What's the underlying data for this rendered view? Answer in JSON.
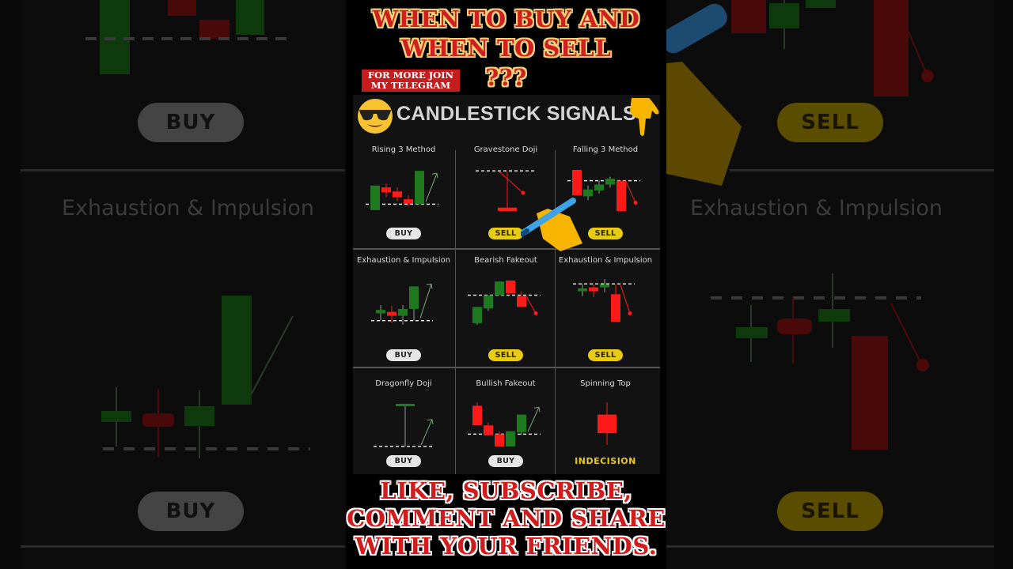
{
  "headline_top": [
    "WHEN TO BUY AND",
    "WHEN TO SELL",
    "???"
  ],
  "telegram_note": [
    "FOR MORE JOIN",
    "MY TELEGRAM"
  ],
  "card": {
    "title": "CANDLESTICK SIGNALS",
    "left_icon": "sunglasses-face-emoji",
    "right_icon": "pointing-down-hand-emoji",
    "overlay_icon": "writing-hand-emoji"
  },
  "headline_bottom": [
    "LIKE, SUBSCRIBE,",
    "COMMENT AND SHARE",
    "WITH YOUR FRIENDS."
  ],
  "colors": {
    "bull": "#1f7a1f",
    "bear": "#ff1a1a",
    "buy_pill": "#e6e6e6",
    "sell_pill": "#e8cc14",
    "headline_red": "#cf1f1f",
    "card_bg": "#121212"
  },
  "patterns": [
    {
      "name": "Rising 3 Method",
      "signal": "BUY",
      "level": 0.78,
      "arrow": "up",
      "candles": [
        {
          "type": "bull",
          "open": 0.9,
          "close": 0.4,
          "high": 0.4,
          "low": 0.9
        },
        {
          "type": "bear",
          "open": 0.44,
          "close": 0.54,
          "high": 0.36,
          "low": 0.64
        },
        {
          "type": "bear",
          "open": 0.52,
          "close": 0.64,
          "high": 0.44,
          "low": 0.72
        },
        {
          "type": "bear",
          "open": 0.68,
          "close": 0.77,
          "high": 0.6,
          "low": 0.82
        },
        {
          "type": "bull",
          "open": 0.78,
          "close": 0.1,
          "high": 0.1,
          "low": 0.78
        }
      ]
    },
    {
      "name": "Gravestone Doji",
      "signal": "SELL",
      "level": 0.1,
      "arrow": "down-dot",
      "candles": [
        {
          "type": "bear",
          "open": 0.85,
          "close": 0.92,
          "high": 0.12,
          "low": 0.92,
          "wide": true
        }
      ]
    },
    {
      "name": "Falling 3 Method",
      "signal": "SELL",
      "level": 0.3,
      "arrow": "down-dot",
      "candles": [
        {
          "type": "bear",
          "open": 0.08,
          "close": 0.6,
          "high": 0.08,
          "low": 0.6
        },
        {
          "type": "bull",
          "open": 0.62,
          "close": 0.48,
          "high": 0.4,
          "low": 0.7
        },
        {
          "type": "bull",
          "open": 0.5,
          "close": 0.38,
          "high": 0.3,
          "low": 0.56
        },
        {
          "type": "bull",
          "open": 0.38,
          "close": 0.26,
          "high": 0.22,
          "low": 0.44
        },
        {
          "type": "bear",
          "open": 0.3,
          "close": 0.92,
          "high": 0.3,
          "low": 0.92
        }
      ]
    },
    {
      "name": "Exhaustion & Impulsion",
      "signal": "BUY",
      "level": 0.9,
      "arrow": "up",
      "candles": [
        {
          "type": "bull",
          "open": 0.75,
          "close": 0.68,
          "high": 0.58,
          "low": 0.9
        },
        {
          "type": "bear",
          "open": 0.72,
          "close": 0.8,
          "high": 0.6,
          "low": 0.95
        },
        {
          "type": "bull",
          "open": 0.8,
          "close": 0.66,
          "high": 0.58,
          "low": 0.98
        },
        {
          "type": "bull",
          "open": 0.66,
          "close": 0.2,
          "high": 0.2,
          "low": 0.9
        }
      ]
    },
    {
      "name": "Bearish Fakeout",
      "signal": "SELL",
      "level": 0.38,
      "arrow": "down-dot",
      "candles": [
        {
          "type": "bull",
          "open": 0.95,
          "close": 0.62,
          "high": 0.62,
          "low": 0.98
        },
        {
          "type": "bull",
          "open": 0.65,
          "close": 0.38,
          "high": 0.38,
          "low": 0.7
        },
        {
          "type": "bull",
          "open": 0.38,
          "close": 0.1,
          "high": 0.1,
          "low": 0.38
        },
        {
          "type": "bear",
          "open": 0.08,
          "close": 0.34,
          "high": 0.08,
          "low": 0.34
        },
        {
          "type": "bear",
          "open": 0.4,
          "close": 0.62,
          "high": 0.3,
          "low": 0.62
        }
      ]
    },
    {
      "name": "Exhaustion & Impulsion",
      "signal": "SELL",
      "level": 0.15,
      "arrow": "down-dot",
      "candles": [
        {
          "type": "bull",
          "open": 0.3,
          "close": 0.24,
          "high": 0.15,
          "low": 0.4
        },
        {
          "type": "bear",
          "open": 0.22,
          "close": 0.3,
          "high": 0.15,
          "low": 0.42
        },
        {
          "type": "bull",
          "open": 0.22,
          "close": 0.16,
          "high": 0.05,
          "low": 0.32
        },
        {
          "type": "bear",
          "open": 0.36,
          "close": 0.92,
          "high": 0.15,
          "low": 0.92
        }
      ]
    },
    {
      "name": "Dragonfly Doji",
      "signal": "BUY",
      "level": 0.95,
      "arrow": "up",
      "candles": [
        {
          "type": "bull",
          "open": 0.08,
          "close": 0.13,
          "high": 0.08,
          "low": 0.95,
          "wide": true
        }
      ]
    },
    {
      "name": "Bullish Fakeout",
      "signal": "BUY",
      "level": 0.7,
      "arrow": "up",
      "candles": [
        {
          "type": "bear",
          "open": 0.12,
          "close": 0.52,
          "high": 0.05,
          "low": 0.52
        },
        {
          "type": "bear",
          "open": 0.52,
          "close": 0.72,
          "high": 0.46,
          "low": 0.72
        },
        {
          "type": "bear",
          "open": 0.7,
          "close": 0.95,
          "high": 0.64,
          "low": 0.95
        },
        {
          "type": "bull",
          "open": 0.95,
          "close": 0.64,
          "high": 0.64,
          "low": 0.95
        },
        {
          "type": "bull",
          "open": 0.66,
          "close": 0.3,
          "high": 0.3,
          "low": 0.72
        }
      ]
    },
    {
      "name": "Spinning Top",
      "signal": "INDECISION",
      "level": null,
      "arrow": null,
      "candles": [
        {
          "type": "bear",
          "open": 0.3,
          "close": 0.68,
          "high": 0.05,
          "low": 0.92,
          "wide": true
        }
      ]
    }
  ],
  "background_ghost": {
    "left_top_signal": "BUY",
    "left_title": "Exhaustion & Impulsion",
    "left_bottom_signal": "BUY",
    "right_top_signal": "SELL",
    "right_title": "Exhaustion & Impulsion",
    "right_bottom_signal": "SELL"
  }
}
